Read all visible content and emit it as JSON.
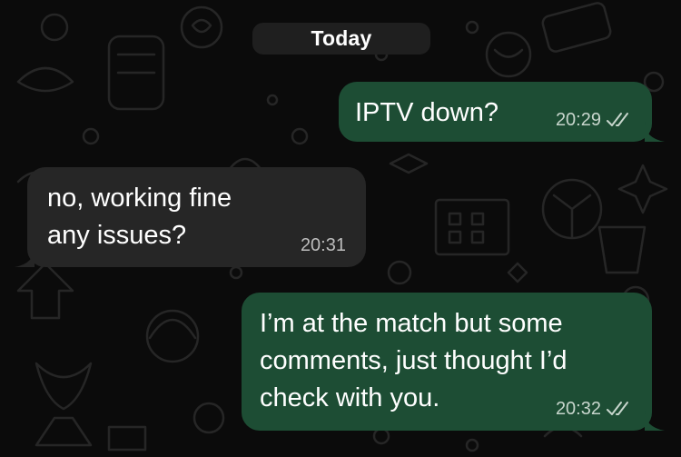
{
  "date_separator": "Today",
  "messages": [
    {
      "direction": "outgoing",
      "text": "IPTV down?",
      "time": "20:29",
      "status_icon": "double-check-icon"
    },
    {
      "direction": "incoming",
      "text": "no, working fine\nany issues?",
      "time": "20:31"
    },
    {
      "direction": "outgoing",
      "text": "I’m at the match but some\ncomments, just thought I’d\ncheck with you.",
      "time": "20:32",
      "status_icon": "double-check-icon"
    }
  ],
  "colors": {
    "background": "#0b0b0b",
    "outgoing_bubble": "#1d4d34",
    "incoming_bubble": "#262626",
    "date_pill": "#1f1f1f",
    "doodle": "#262626"
  }
}
